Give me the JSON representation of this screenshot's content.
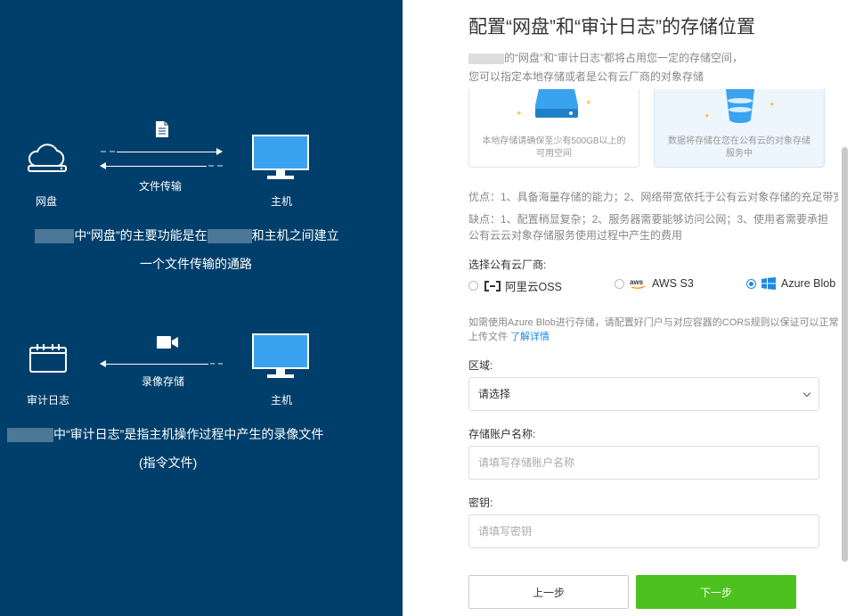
{
  "left": {
    "flow1": {
      "source_label": "网盘",
      "target_label": "主机",
      "arrow_label": "文件传输",
      "desc_line1_a": "中“网盘”的主要功能是在",
      "desc_line1_b": "和主机之间建立",
      "desc_line2": "一个文件传输的通路"
    },
    "flow2": {
      "source_label": "审计日志",
      "target_label": "主机",
      "arrow_label": "录像存储",
      "desc_line1": "中“审计日志”是指主机操作过程中产生的录像文件",
      "desc_line2": "(指令文件)"
    }
  },
  "right": {
    "title": "配置“网盘”和“审计日志”的存储位置",
    "subtitle1": "的“网盘”和“审计日志”都将占用您一定的存储空间，",
    "subtitle2": "您可以指定本地存储或者是公有云厂商的对象存储",
    "cards": [
      {
        "text": "本地存储请确保至少有500GB以上的可用空间",
        "selected": false
      },
      {
        "text": "数据将存储在您在公有云的对象存储服务中",
        "selected": true
      }
    ],
    "pros": "优点：1、具备海量存储的能力；2、网络带宽依托于公有云对象存储的充足带宽",
    "cons": "缺点：1、配置稍显复杂；2、服务器需要能够访问公网；3、使用者需要承担公有云云对象存储服务使用过程中产生的费用",
    "provider_label": "选择公有云厂商:",
    "providers": [
      {
        "label": "阿里云OSS",
        "selected": false
      },
      {
        "label": "AWS S3",
        "selected": false
      },
      {
        "label": "Azure Blob",
        "selected": true
      }
    ],
    "note": "如需使用Azure Blob进行存储，请配置好门户与对应容器的CORS规则以保证可以正常上传文件",
    "note_link": "了解详情",
    "region_label": "区域:",
    "region_value": "请选择",
    "account_label": "存储账户名称:",
    "account_placeholder": "请填写存储账户名称",
    "key_label": "密钥:",
    "key_placeholder": "请填写密钥",
    "prev_button": "上一步",
    "next_button": "下一步"
  },
  "colors": {
    "left_bg": "#003f6b",
    "next_button": "#4cc11f",
    "link": "#1e88e5",
    "monitor": "#3aa3f0"
  }
}
